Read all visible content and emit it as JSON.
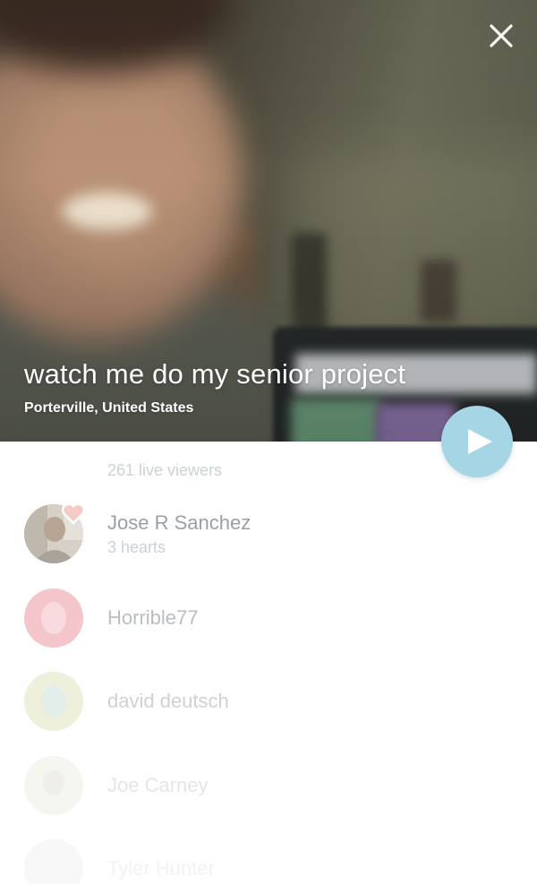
{
  "broadcast": {
    "title": "watch me do my senior project",
    "location": "Porterville, United States"
  },
  "controls": {
    "close_icon": "close-icon",
    "play_icon": "play-icon",
    "play_button_color": "#a6d6e6"
  },
  "viewers": {
    "count_label": "261 live viewers",
    "list": [
      {
        "name": "Jose R Sanchez",
        "subtitle": "3 hearts",
        "name_color": "#9aa0a3",
        "sub_color": "#c9d2d6",
        "badge": "heart-icon"
      },
      {
        "name": "Horrible77",
        "subtitle": "",
        "name_color": "#b9bec1",
        "sub_color": "#c9d2d6"
      },
      {
        "name": "david deutsch",
        "subtitle": "",
        "name_color": "#ced2d4",
        "sub_color": "#c9d2d6"
      },
      {
        "name": "Joe Carney",
        "subtitle": "",
        "name_color": "#e3e6e7",
        "sub_color": "#c9d2d6"
      },
      {
        "name": "Tyler Hunter",
        "subtitle": "",
        "name_color": "#f0f2f3",
        "sub_color": "#c9d2d6"
      }
    ]
  }
}
